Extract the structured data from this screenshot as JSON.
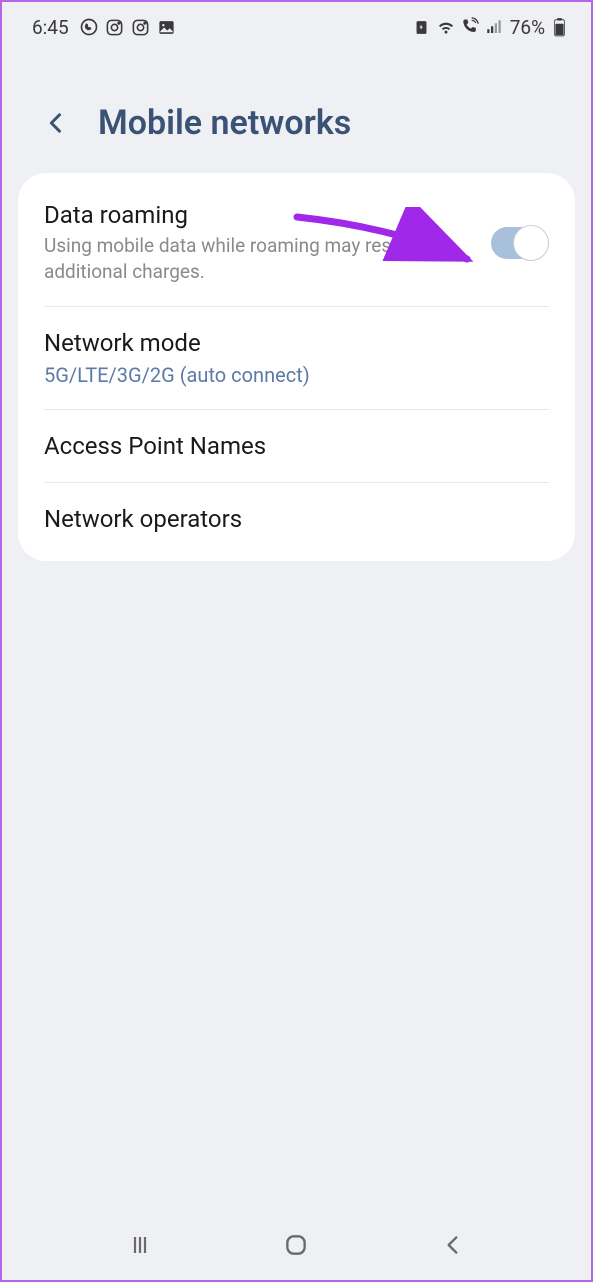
{
  "statusBar": {
    "time": "6:45",
    "batteryPercent": "76%"
  },
  "header": {
    "title": "Mobile networks"
  },
  "settings": {
    "dataRoaming": {
      "title": "Data roaming",
      "subtitle": "Using mobile data while roaming may result in additional charges."
    },
    "networkMode": {
      "title": "Network mode",
      "value": "5G/LTE/3G/2G (auto connect)"
    },
    "apn": {
      "title": "Access Point Names"
    },
    "networkOperators": {
      "title": "Network operators"
    }
  }
}
